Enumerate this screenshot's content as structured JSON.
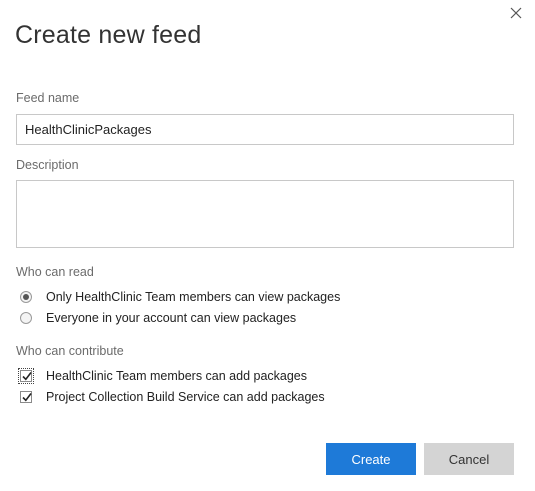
{
  "dialog": {
    "title": "Create new feed",
    "close_icon": "close-icon"
  },
  "feed_name": {
    "label": "Feed name",
    "value": "HealthClinicPackages"
  },
  "description": {
    "label": "Description",
    "value": ""
  },
  "read": {
    "label": "Who can read",
    "options": [
      {
        "label": "Only HealthClinic Team members can view packages",
        "selected": true
      },
      {
        "label": "Everyone in your account can view packages",
        "selected": false
      }
    ]
  },
  "contribute": {
    "label": "Who can contribute",
    "options": [
      {
        "label": "HealthClinic Team members can add packages",
        "checked": true
      },
      {
        "label": "Project Collection Build Service can add packages",
        "checked": true
      }
    ]
  },
  "buttons": {
    "create": "Create",
    "cancel": "Cancel"
  },
  "colors": {
    "primary": "#1e7ad8",
    "secondary": "#d4d4d4"
  }
}
